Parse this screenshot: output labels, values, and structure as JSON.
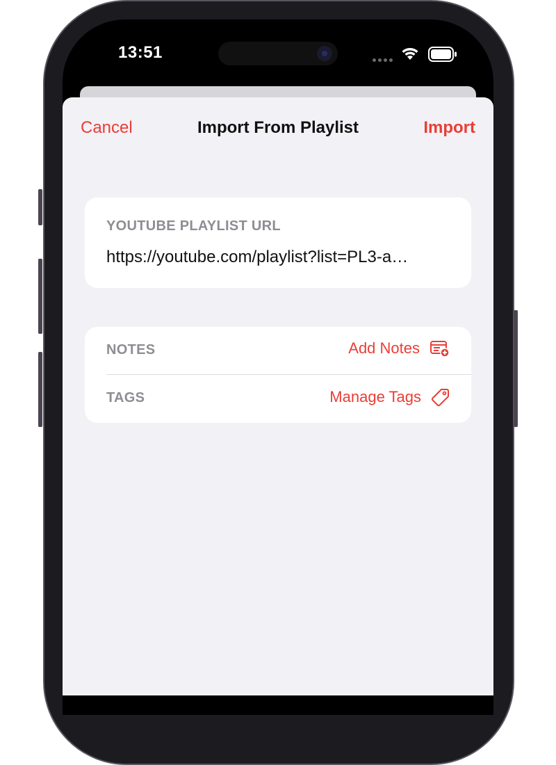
{
  "status_bar": {
    "time": "13:51"
  },
  "nav": {
    "cancel_label": "Cancel",
    "title": "Import From Playlist",
    "import_label": "Import"
  },
  "url_section": {
    "label": "YOUTUBE PLAYLIST URL",
    "value": "https://youtube.com/playlist?list=PL3-a…"
  },
  "notes_row": {
    "label": "NOTES",
    "action_label": "Add Notes",
    "icon": "note-add-icon"
  },
  "tags_row": {
    "label": "TAGS",
    "action_label": "Manage Tags",
    "icon": "tag-icon"
  },
  "colors": {
    "accent": "#ea3d36",
    "sheet_background": "#f2f1f6",
    "card_background": "#ffffff",
    "secondary_text": "#8e8d93"
  }
}
